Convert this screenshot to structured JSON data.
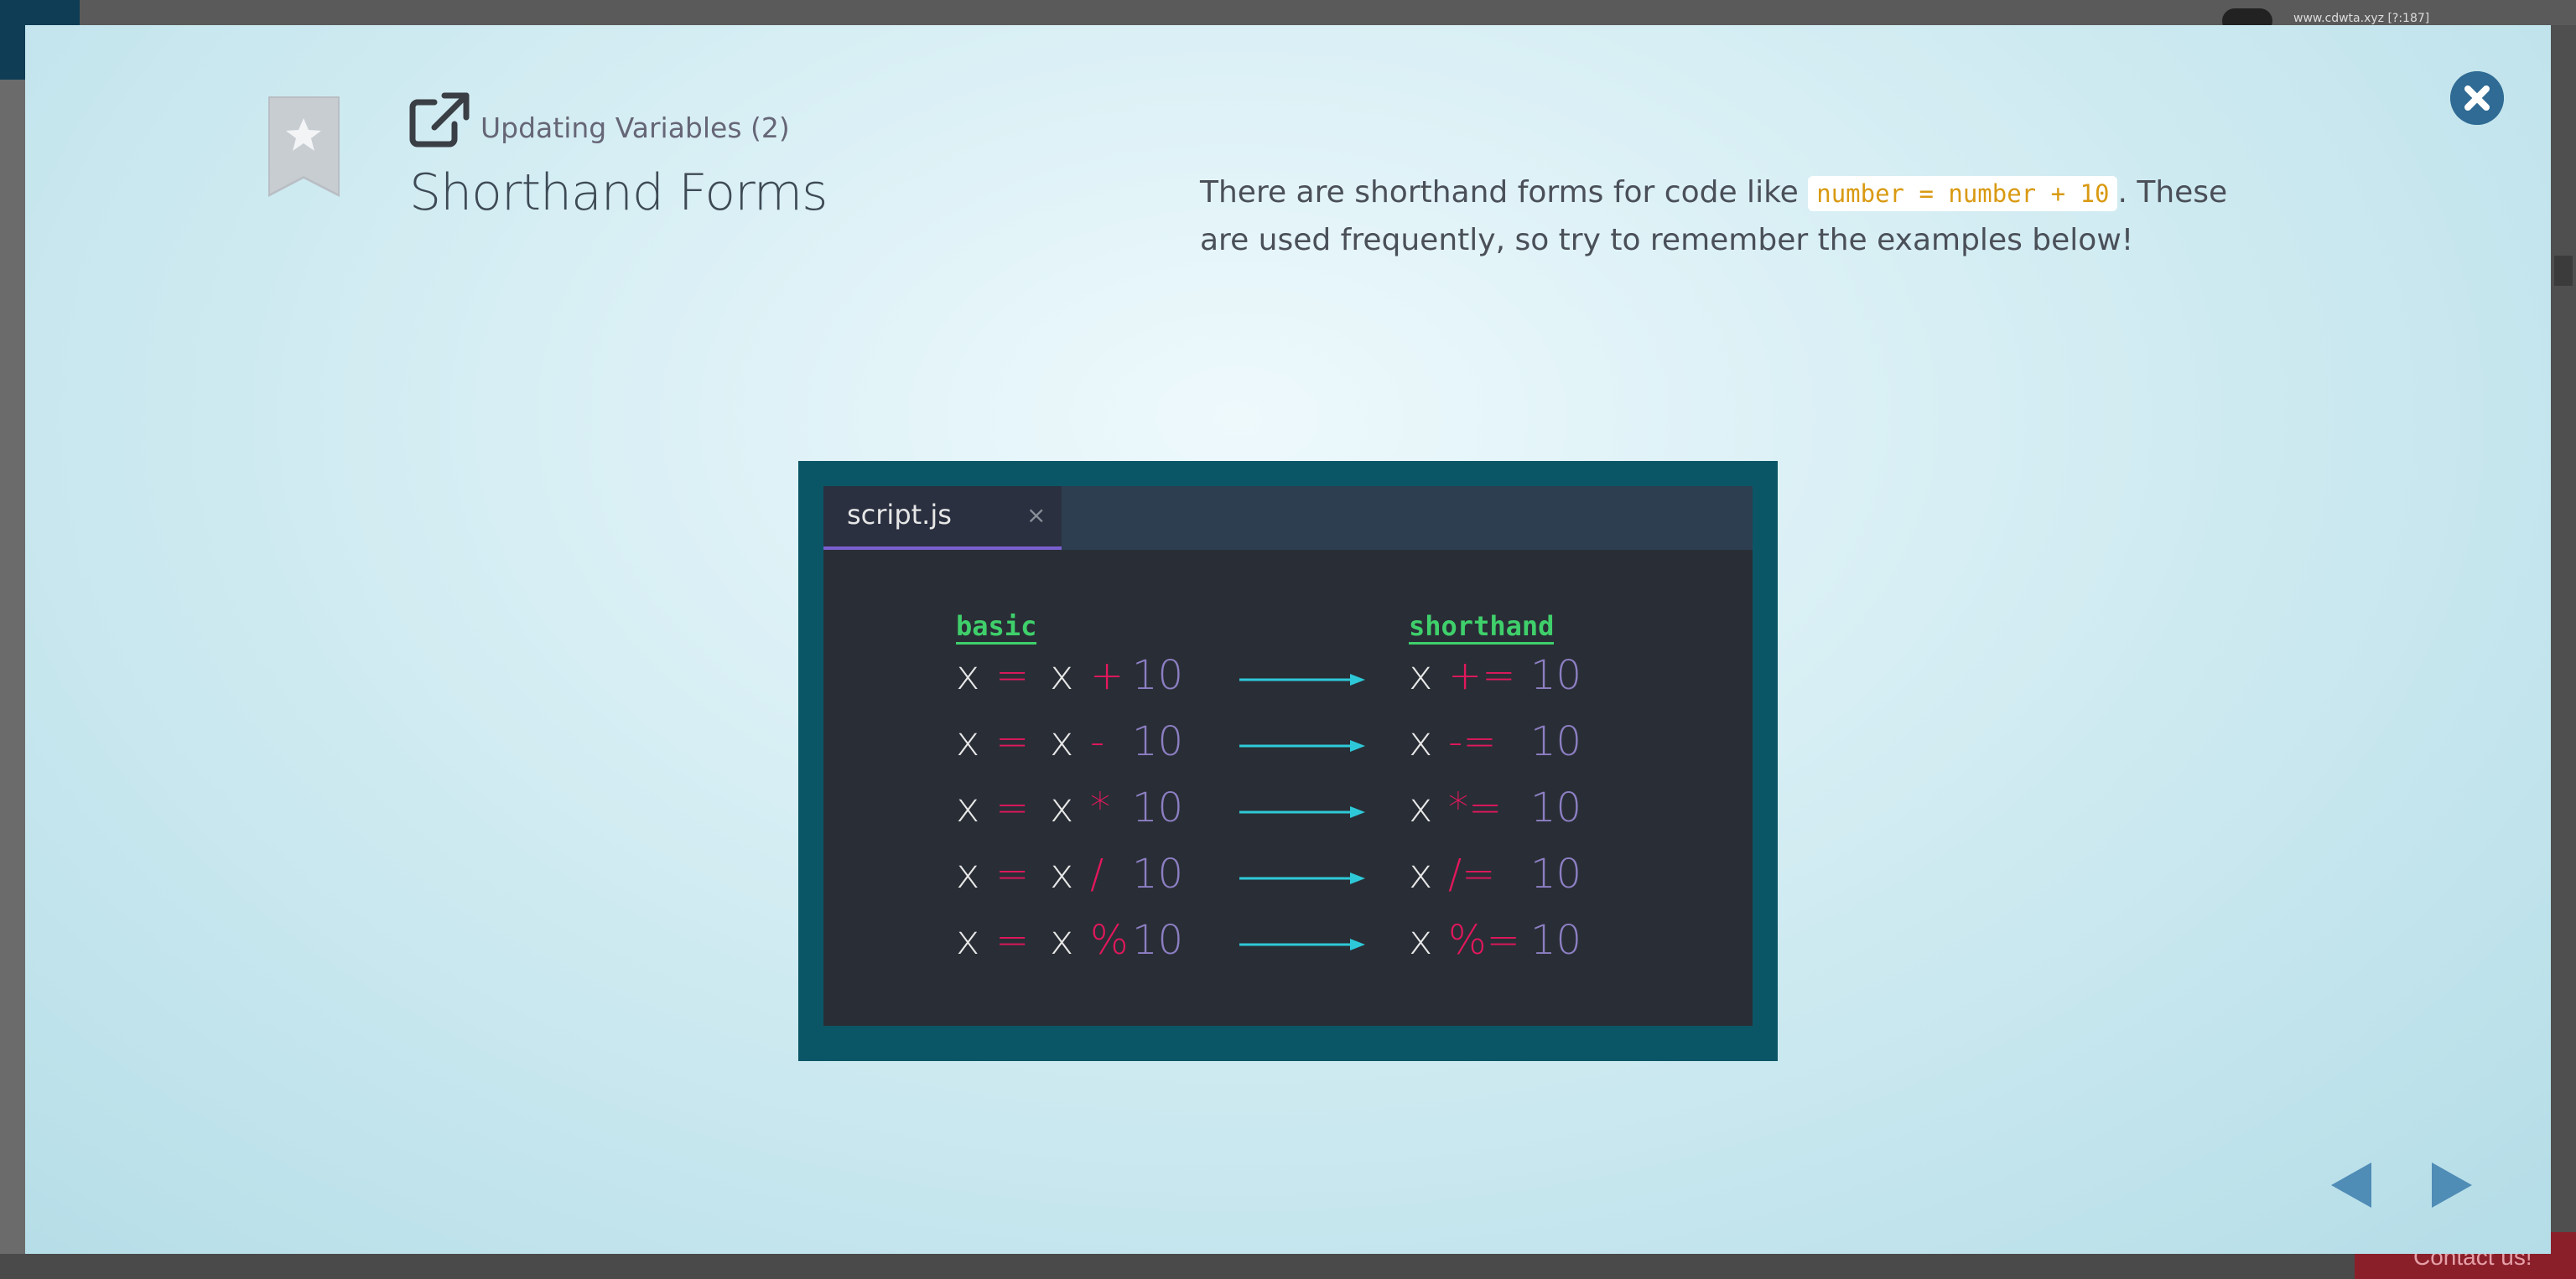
{
  "background": {
    "url_text": "www.cdwta.xyz [?:187]",
    "contact_label": "Contact us!"
  },
  "lesson": {
    "subtitle": "Updating Variables (2)",
    "title": "Shorthand Forms",
    "description_before": "There are shorthand forms for code like ",
    "description_code": "number = number + 10",
    "description_after": ". These are used frequently, so try to remember the examples below!"
  },
  "illustration": {
    "tab_label": "script.js",
    "tab_close": "×",
    "header_basic": "basic",
    "header_shorthand": "shorthand",
    "rows": [
      {
        "var": "x",
        "eq": "=",
        "var2": "x",
        "op": "+",
        "num": "10",
        "sh_var": "x",
        "sh_op": "+=",
        "sh_num": "10"
      },
      {
        "var": "x",
        "eq": "=",
        "var2": "x",
        "op": "-",
        "num": "10",
        "sh_var": "x",
        "sh_op": "-=",
        "sh_num": "10"
      },
      {
        "var": "x",
        "eq": "=",
        "var2": "x",
        "op": "*",
        "num": "10",
        "sh_var": "x",
        "sh_op": "*=",
        "sh_num": "10"
      },
      {
        "var": "x",
        "eq": "=",
        "var2": "x",
        "op": "/",
        "num": "10",
        "sh_var": "x",
        "sh_op": "/=",
        "sh_num": "10"
      },
      {
        "var": "x",
        "eq": "=",
        "var2": "x",
        "op": "%",
        "num": "10",
        "sh_var": "x",
        "sh_op": "%=",
        "sh_num": "10"
      }
    ]
  },
  "icons": {
    "bookmark": "bookmark-star-icon",
    "external_link": "external-link-icon",
    "close": "close-icon",
    "prev": "previous-arrow-icon",
    "next": "next-arrow-icon"
  },
  "colors": {
    "accent": "#2f6b94",
    "code_highlight": "#d99a12",
    "illustration_frame": "#0b5666",
    "editor_bg": "#292e36",
    "operator": "#e3175c",
    "number": "#8d7fc4",
    "header_green": "#3fd06b",
    "arrow": "#2ec9d8"
  }
}
